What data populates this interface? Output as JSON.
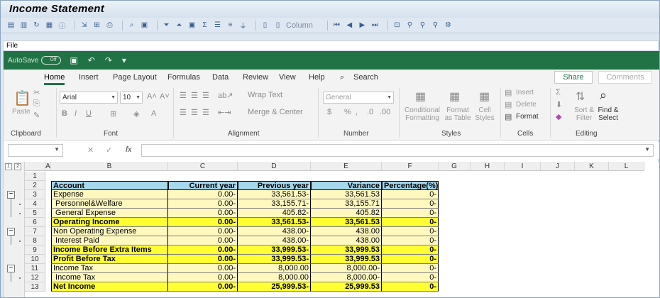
{
  "window": {
    "title": "Income Statement"
  },
  "sap_toolbar": {
    "column_label": "Column"
  },
  "menu": {
    "file": "File"
  },
  "qat": {
    "autosave": "AutoSave",
    "toggle": "Off"
  },
  "ribbon_tabs": [
    "Home",
    "Insert",
    "Page Layout",
    "Formulas",
    "Data",
    "Review",
    "View",
    "Help",
    "Search"
  ],
  "share": "Share",
  "comments": "Comments",
  "ribbon": {
    "clipboard": {
      "label": "Clipboard",
      "paste": "Paste"
    },
    "font": {
      "label": "Font",
      "family": "Arial",
      "size": "10"
    },
    "alignment": {
      "label": "Alignment",
      "wrap": "Wrap Text",
      "merge": "Merge & Center"
    },
    "number": {
      "label": "Number",
      "format": "General"
    },
    "styles": {
      "label": "Styles",
      "conditional": "Conditional Formatting",
      "format_table": "Format as Table",
      "cell_styles": "Cell Styles"
    },
    "cells": {
      "label": "Cells",
      "insert": "Insert",
      "delete": "Delete",
      "format": "Format"
    },
    "editing": {
      "label": "Editing",
      "sort": "Sort & Filter",
      "find": "Find & Select"
    }
  },
  "formula_bar": {
    "fx": "fx"
  },
  "outline_levels": [
    "1",
    "2"
  ],
  "columns": [
    "A",
    "B",
    "C",
    "D",
    "E",
    "F",
    "G",
    "H",
    "I",
    "J",
    "K",
    "L"
  ],
  "rows": [
    "1",
    "2",
    "3",
    "4",
    "5",
    "6",
    "7",
    "8",
    "9",
    "10",
    "11",
    "12",
    "13"
  ],
  "table": {
    "headers": [
      "Account",
      "Current year",
      "Previous year",
      "Variance",
      "Percentage(%)"
    ],
    "rows": [
      {
        "account": "Expense",
        "current": "0.00-",
        "previous": "33,561.53-",
        "variance": "33,561.53",
        "pct": "0-",
        "style": "yl"
      },
      {
        "account": " Personnel&Welfare",
        "current": "0.00-",
        "previous": "33,155.71-",
        "variance": "33,155.71",
        "pct": "0-",
        "style": "yl"
      },
      {
        "account": " General Expense",
        "current": "0.00-",
        "previous": "405.82-",
        "variance": "405.82",
        "pct": "0-",
        "style": "yl"
      },
      {
        "account": "Operating Income",
        "current": "0.00-",
        "previous": "33,561.53-",
        "variance": "33,561.53",
        "pct": "0-",
        "style": "yd"
      },
      {
        "account": "Non Operating Expense",
        "current": "0.00-",
        "previous": "438.00-",
        "variance": "438.00",
        "pct": "0-",
        "style": "yl"
      },
      {
        "account": " Interest Paid",
        "current": "0.00-",
        "previous": "438.00-",
        "variance": "438.00",
        "pct": "0-",
        "style": "yl"
      },
      {
        "account": "Income Before Extra Items",
        "current": "0.00-",
        "previous": "33,999.53-",
        "variance": "33,999.53",
        "pct": "0-",
        "style": "yd"
      },
      {
        "account": "Profit Before Tax",
        "current": "0.00-",
        "previous": "33,999.53-",
        "variance": "33,999.53",
        "pct": "0-",
        "style": "yd"
      },
      {
        "account": "Income Tax",
        "current": "0.00-",
        "previous": "8,000.00",
        "variance": "8,000.00-",
        "pct": "0-",
        "style": "yl"
      },
      {
        "account": " Income Tax",
        "current": "0.00-",
        "previous": "8,000.00",
        "variance": "8,000.00-",
        "pct": "0-",
        "style": "yl"
      },
      {
        "account": "Net Income",
        "current": "0.00-",
        "previous": "25,999.53-",
        "variance": "25,999.53",
        "pct": "0-",
        "style": "yd"
      }
    ]
  }
}
